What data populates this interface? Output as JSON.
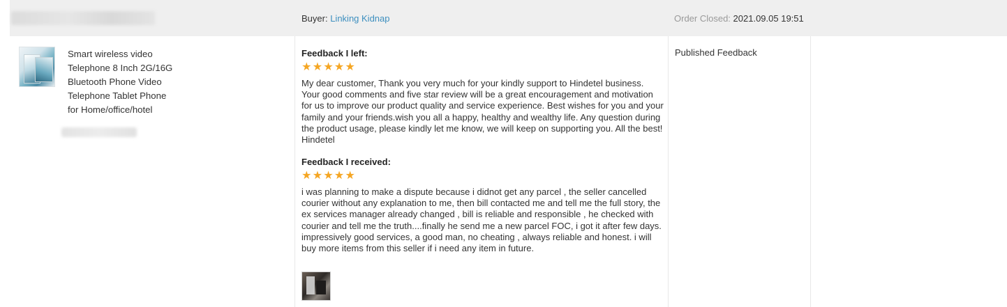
{
  "order": {
    "buyer_label": "Buyer:",
    "buyer_name": "Linking Kidnap",
    "status_label": "Order Closed:",
    "status_time": "2021.09.05 19:51"
  },
  "product": {
    "title_lines": [
      "Smart wireless video",
      "Telephone 8 Inch 2G/16G",
      "Bluetooth Phone Video",
      "Telephone Tablet Phone",
      "for Home/office/hotel"
    ]
  },
  "feedback_left": {
    "heading": "Feedback I left:",
    "rating": 5,
    "text": "My dear customer, Thank you very much for your kindly support to Hindetel business. Your good comments and five star review will be a great encouragement and motivation for us to improve our product quality and service experience. Best wishes for you and your family and your friends.wish you all a happy, healthy and wealthy life. Any question during the product usage, please kindly let me know, we will keep on supporting you. All the best! Hindetel"
  },
  "feedback_received": {
    "heading": "Feedback I received:",
    "rating": 5,
    "text": "i was planning to make a dispute because i didnot get any parcel , the seller cancelled courier without any explanation to me, then bill contacted me and tell me the full story, the ex services manager already changed , bill is reliable and responsible , he checked with courier and tell me the truth....finally he send me a new parcel FOC, i got it after few days. impressively good services, a good man, no cheating , always reliable and honest. i will buy more items from this seller if i need any item in future."
  },
  "status_column": {
    "label": "Published Feedback"
  },
  "colors": {
    "header_bg": "#efefef",
    "link": "#3d8fbf",
    "star": "#f5a623"
  },
  "icons": {
    "star": "star-icon"
  }
}
